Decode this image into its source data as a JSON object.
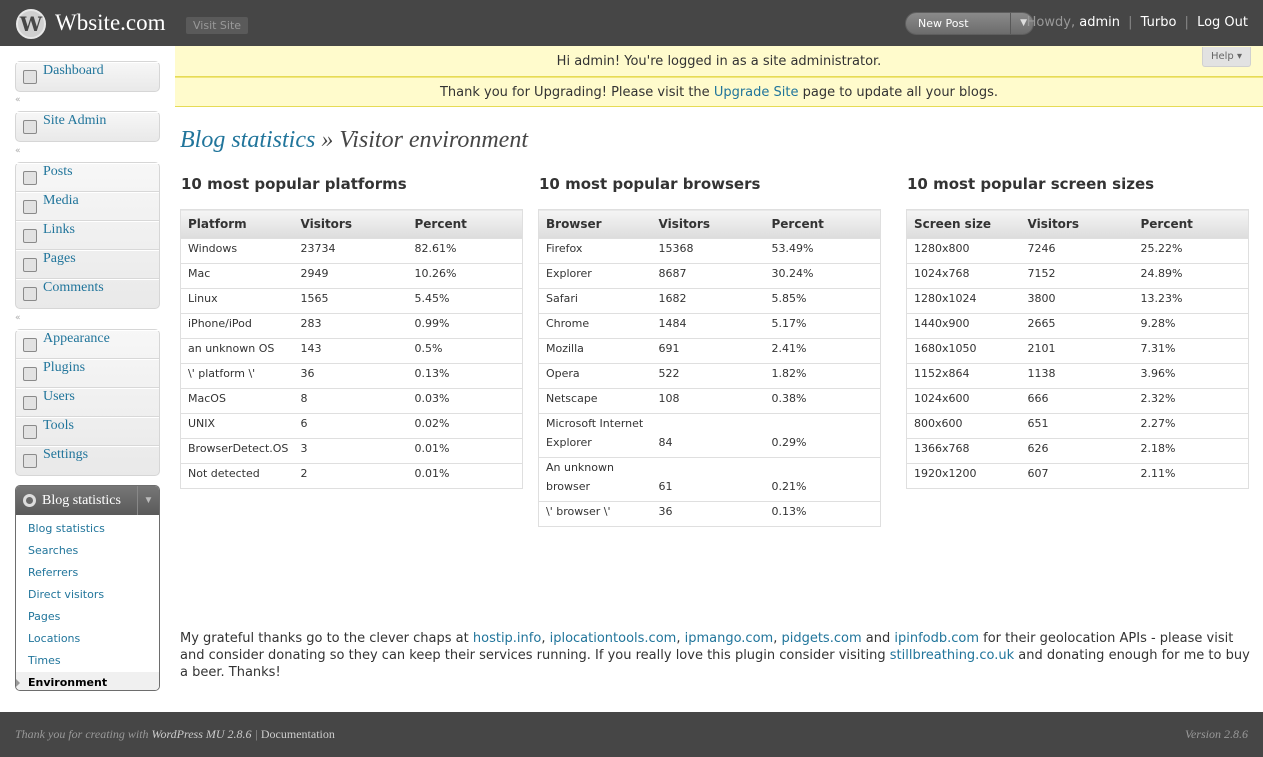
{
  "header": {
    "logo_glyph": "W",
    "site_title": "Wbsite.com",
    "visit_site": "Visit Site",
    "new_post": "New Post",
    "howdy": "Howdy,",
    "user": "admin",
    "turbo": "Turbo",
    "logout": "Log Out"
  },
  "notices": {
    "logged_in": "Hi admin! You're logged in as a site administrator.",
    "upgrade_prefix": "Thank you for Upgrading! Please visit the",
    "upgrade_link": "Upgrade Site",
    "upgrade_suffix": "page to update all your blogs.",
    "help": "Help"
  },
  "sidebar": {
    "group1": [
      {
        "label": "Dashboard",
        "icon": "dashboard-icon"
      }
    ],
    "group2": [
      {
        "label": "Site Admin",
        "icon": "site-admin-icon"
      }
    ],
    "group3": [
      {
        "label": "Posts",
        "icon": "pin-icon"
      },
      {
        "label": "Media",
        "icon": "media-icon"
      },
      {
        "label": "Links",
        "icon": "link-icon"
      },
      {
        "label": "Pages",
        "icon": "pages-icon"
      },
      {
        "label": "Comments",
        "icon": "comment-icon"
      }
    ],
    "group4": [
      {
        "label": "Appearance",
        "icon": "appearance-icon"
      },
      {
        "label": "Plugins",
        "icon": "plugin-icon"
      },
      {
        "label": "Users",
        "icon": "users-icon"
      },
      {
        "label": "Tools",
        "icon": "tools-icon"
      },
      {
        "label": "Settings",
        "icon": "settings-icon"
      }
    ],
    "active_menu": {
      "title": "Blog statistics",
      "items": [
        "Blog statistics",
        "Searches",
        "Referrers",
        "Direct visitors",
        "Pages",
        "Locations",
        "Times",
        "Environment"
      ],
      "current": "Environment"
    }
  },
  "page": {
    "title_link": "Blog statistics",
    "title_rest": "» Visitor environment"
  },
  "platforms": {
    "title": "10 most popular platforms",
    "headers": [
      "Platform",
      "Visitors",
      "Percent"
    ],
    "rows": [
      [
        "Windows",
        "23734",
        "82.61%"
      ],
      [
        "Mac",
        "2949",
        "10.26%"
      ],
      [
        "Linux",
        "1565",
        "5.45%"
      ],
      [
        "iPhone/iPod",
        "283",
        "0.99%"
      ],
      [
        "an unknown OS",
        "143",
        "0.5%"
      ],
      [
        "\\' platform \\'",
        "36",
        "0.13%"
      ],
      [
        "MacOS",
        "8",
        "0.03%"
      ],
      [
        "UNIX",
        "6",
        "0.02%"
      ],
      [
        "BrowserDetect.OS",
        "3",
        "0.01%"
      ],
      [
        "Not detected",
        "2",
        "0.01%"
      ]
    ]
  },
  "browsers": {
    "title": "10 most popular browsers",
    "headers": [
      "Browser",
      "Visitors",
      "Percent"
    ],
    "rows": [
      [
        "Firefox",
        "15368",
        "53.49%"
      ],
      [
        "Explorer",
        "8687",
        "30.24%"
      ],
      [
        "Safari",
        "1682",
        "5.85%"
      ],
      [
        "Chrome",
        "1484",
        "5.17%"
      ],
      [
        "Mozilla",
        "691",
        "2.41%"
      ],
      [
        "Opera",
        "522",
        "1.82%"
      ],
      [
        "Netscape",
        "108",
        "0.38%"
      ],
      [
        "Microsoft Internet Explorer",
        "84",
        "0.29%"
      ],
      [
        "An unknown browser",
        "61",
        "0.21%"
      ],
      [
        "\\' browser \\'",
        "36",
        "0.13%"
      ]
    ]
  },
  "screens": {
    "title": "10 most popular screen sizes",
    "headers": [
      "Screen size",
      "Visitors",
      "Percent"
    ],
    "rows": [
      [
        "1280x800",
        "7246",
        "25.22%"
      ],
      [
        "1024x768",
        "7152",
        "24.89%"
      ],
      [
        "1280x1024",
        "3800",
        "13.23%"
      ],
      [
        "1440x900",
        "2665",
        "9.28%"
      ],
      [
        "1680x1050",
        "2101",
        "7.31%"
      ],
      [
        "1152x864",
        "1138",
        "3.96%"
      ],
      [
        "1024x600",
        "666",
        "2.32%"
      ],
      [
        "800x600",
        "651",
        "2.27%"
      ],
      [
        "1366x768",
        "626",
        "2.18%"
      ],
      [
        "1920x1200",
        "607",
        "2.11%"
      ]
    ]
  },
  "footnote": {
    "prefix": "My grateful thanks go to the clever chaps at",
    "links": [
      "hostip.info",
      "iplocationtools.com",
      "ipmango.com",
      "pidgets.com",
      "ipinfodb.com"
    ],
    "and": "and",
    "middle": "for their geolocation APIs - please visit and consider donating so they can keep their services running. If you really love this plugin consider visiting",
    "link2": "stillbreathing.co.uk",
    "suffix": "and donating enough for me to buy a beer. Thanks!"
  },
  "footer": {
    "thanks": "Thank you for creating with",
    "wpmu": "WordPress MU 2.8.6",
    "documentation": "Documentation",
    "version": "Version 2.8.6"
  }
}
